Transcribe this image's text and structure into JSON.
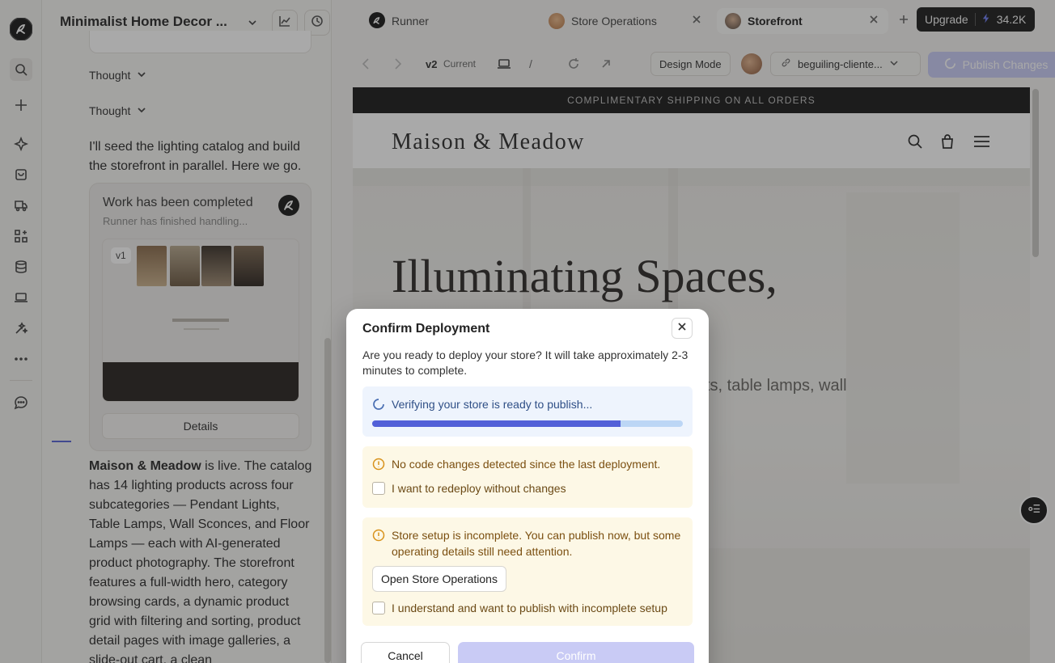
{
  "app": {
    "accent": "#5260d8"
  },
  "rail": {
    "icons": [
      "logo-icon",
      "search-icon",
      "plus-icon",
      "sparkle-icon",
      "bag-icon",
      "truck-icon",
      "apps-icon",
      "database-icon",
      "laptop-icon",
      "magic-icon",
      "more-icon",
      "chat-icon"
    ]
  },
  "chat": {
    "project_title": "Minimalist Home Decor ...",
    "thought_1": "Thought",
    "thought_2": "Thought",
    "message_1": "I'll seed the lighting catalog and build the storefront in parallel. Here we go.",
    "work_card": {
      "title": "Work has been completed",
      "subtitle": "Runner has finished handling...",
      "version_badge": "v1",
      "details_label": "Details"
    },
    "final_brand": "Maison & Meadow",
    "final_message": " is live. The catalog has 14 lighting products across four subcategories — Pendant Lights, Table Lamps, Wall Sconces, and Floor Lamps — each with AI-generated product photography. The storefront features a full-width hero, category browsing cards, a dynamic product grid with filtering and sorting, product detail pages with image galleries, a slide-out cart, a clean"
  },
  "tabs": [
    {
      "label": "Runner"
    },
    {
      "label": "Store Operations"
    },
    {
      "label": "Storefront"
    }
  ],
  "upgrade": {
    "label": "Upgrade",
    "credits": "34.2K"
  },
  "toolbar": {
    "version": "v2",
    "version_status": "Current",
    "path_separator": "/",
    "design_mode": "Design Mode",
    "url": "beguiling-cliente...",
    "publish": "Publish Changes"
  },
  "site": {
    "announcement": "COMPLIMENTARY SHIPPING ON ALL ORDERS",
    "brand": "Maison & Meadow",
    "hero_title": "Illuminating Spaces,",
    "hero_sub": "ts, table lamps, wall"
  },
  "dialog": {
    "title": "Confirm Deployment",
    "description": "Are you ready to deploy your store? It will take approximately 2-3 minutes to complete.",
    "verify_text": "Verifying your store is ready to publish...",
    "progress": 0.8,
    "warning_1": "No code changes detected since the last deployment.",
    "checkbox_1": "I want to redeploy without changes",
    "warning_2": "Store setup is incomplete. You can publish now, but some operating details still need attention.",
    "open_ops": "Open Store Operations",
    "checkbox_2": "I understand and want to publish with incomplete setup",
    "cancel": "Cancel",
    "confirm": "Confirm"
  }
}
